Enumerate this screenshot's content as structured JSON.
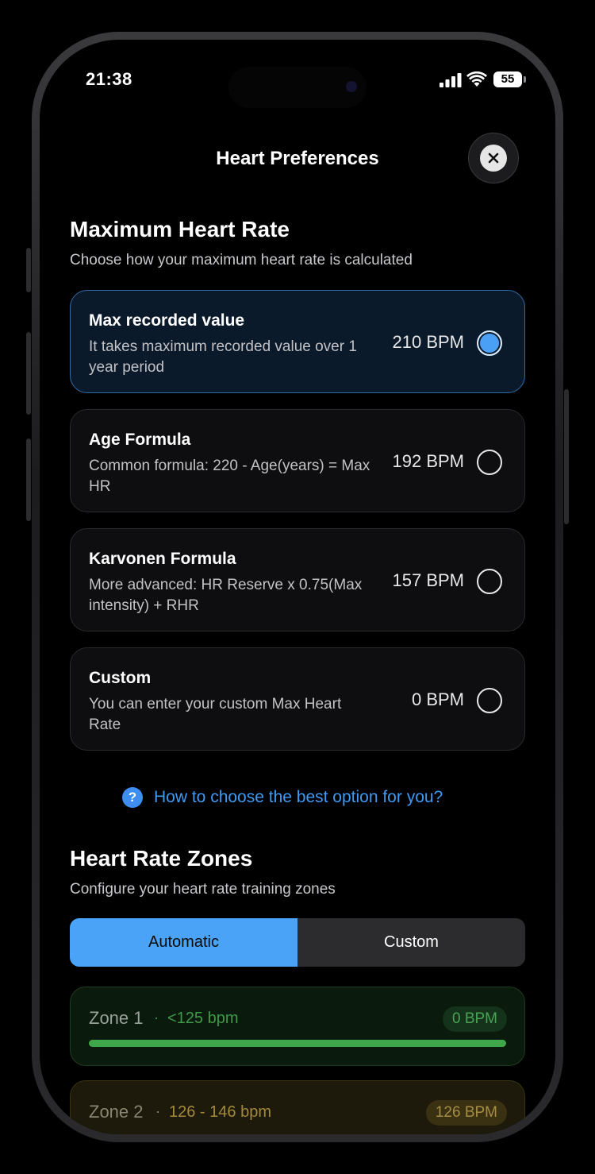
{
  "status": {
    "time": "21:38",
    "battery": "55"
  },
  "header": {
    "title": "Heart Preferences"
  },
  "max_hr": {
    "title": "Maximum Heart Rate",
    "subtitle": "Choose how your maximum heart rate is calculated",
    "options": [
      {
        "title": "Max recorded value",
        "desc": "It takes maximum recorded value over 1 year period",
        "value": "210 BPM",
        "selected": true
      },
      {
        "title": "Age Formula",
        "desc": "Common formula: 220 - Age(years) = Max HR",
        "value": "192 BPM",
        "selected": false
      },
      {
        "title": "Karvonen Formula",
        "desc": "More advanced: HR Reserve x 0.75(Max intensity) + RHR",
        "value": "157 BPM",
        "selected": false
      },
      {
        "title": "Custom",
        "desc": "You can enter your custom Max Heart Rate",
        "value": "0 BPM",
        "selected": false
      }
    ]
  },
  "help": {
    "icon": "?",
    "text": "How to choose the best option for you?"
  },
  "zones": {
    "title": "Heart Rate Zones",
    "subtitle": "Configure your heart rate training zones",
    "tabs": {
      "automatic": "Automatic",
      "custom": "Custom"
    },
    "active_tab": "automatic",
    "separator": "·",
    "items": [
      {
        "name": "Zone 1",
        "range": "<125 bpm",
        "badge": "0 BPM",
        "fill": 1.0,
        "color": "#3fa64a"
      },
      {
        "name": "Zone 2",
        "range": "126 - 146 bpm",
        "badge": "126 BPM",
        "color": "#a3893a"
      }
    ]
  },
  "colors": {
    "accent": "#4aa3f7",
    "link": "#3d9af5",
    "zone1": "#3fa64a",
    "zone2": "#a3893a"
  }
}
